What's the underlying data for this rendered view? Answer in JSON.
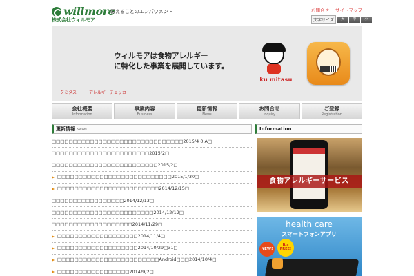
{
  "header": {
    "logo_text": "willmore",
    "logo_sub": "株式会社ウィルモア",
    "tagline": "伝えることのエンパワメント",
    "top_links": [
      "お問合せ",
      "サイトマップ"
    ],
    "font_size": {
      "label": "文字サイズ",
      "buttons": [
        "大",
        "中",
        "小"
      ]
    }
  },
  "hero": {
    "line1": "ウィルモアは食物アレルギー",
    "line2": "に特化した事業を展開しています。",
    "links": [
      "クミタス",
      "アレルギーチェッカー"
    ],
    "brand_label": "ku mitasu"
  },
  "nav": [
    {
      "jp": "会社概要",
      "en": "Information"
    },
    {
      "jp": "事業内容",
      "en": "Business"
    },
    {
      "jp": "更新情報",
      "en": "News"
    },
    {
      "jp": "お問合せ",
      "en": "Inquiry"
    },
    {
      "jp": "ご登録",
      "en": "Registration"
    }
  ],
  "news": {
    "title": "更新情報",
    "title_en": "News",
    "items": [
      {
        "text": "□□□□□□□□□□□□□□□□□□□□□□□□□□□□□□□2015/4 0.A□",
        "arrow": false
      },
      {
        "text": "□□□□□□□□□□□□□□□□□□□□□□□2015/2□",
        "arrow": false
      },
      {
        "text": "□□□□□□□□□□□□□□□□□□□□□□□□□2015/2□",
        "arrow": false
      },
      {
        "text": "□□□□□□□□□□□□□□□□□□□□□□□□□□□2015/1/30□",
        "arrow": true
      },
      {
        "text": "□□□□□□□□□□□□□□□□□□□□□□□□2014/12/15□",
        "arrow": true
      },
      {
        "text": "□□□□□□□□□□□□□□□□□2014/12/13□",
        "arrow": false
      },
      {
        "text": "□□□□□□□□□□□□□□□□□□□□□□□□2014/12/12□",
        "arrow": false
      },
      {
        "text": "□□□□□□□□□□□□□□□□□□□2014/11/29□",
        "arrow": false
      },
      {
        "text": "□□□□□□□□□□□□□□□□□□□2014/11/4□",
        "arrow": true
      },
      {
        "text": "□□□□□□□□□□□□□□□□□□□2014/10/29□31□",
        "arrow": true
      },
      {
        "text": "□□□□□□□□□□□□□□□□□□□□□□□□Android□□□2014/10/4□",
        "arrow": true
      },
      {
        "text": "□□□□□□□□□□□□□□□□□2014/9/2□",
        "arrow": true
      }
    ]
  },
  "info": {
    "title": "Information",
    "banner1_caption": "食物アレルギーサービス",
    "banner2_title": "health care",
    "banner2_sub": "スマートフォンアプリ",
    "badge_new": "NEW!",
    "badge_free": "It's FREE!"
  },
  "colors": {
    "brand_green": "#2e7d3a",
    "link_red": "#dd4444",
    "arrow_orange": "#e08a10"
  }
}
